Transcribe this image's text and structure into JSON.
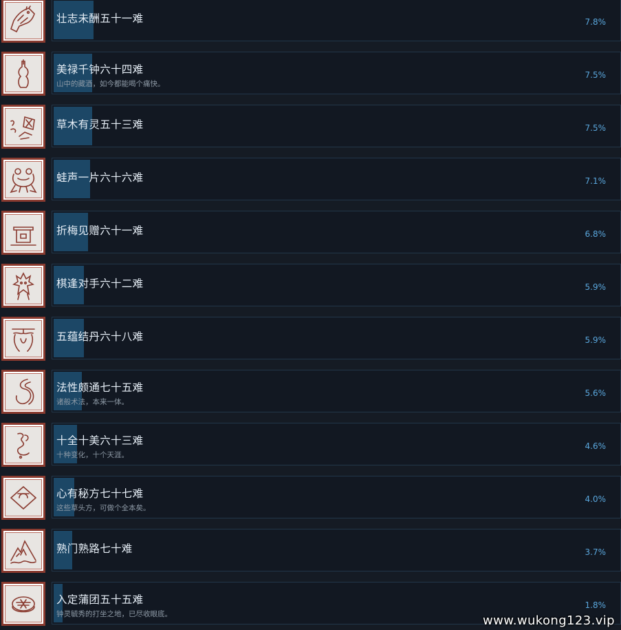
{
  "achievements": [
    {
      "title": "壮志未酬五十一难",
      "desc": "",
      "percent": "7.8%",
      "value": 7.8,
      "icon": "horse-head-icon"
    },
    {
      "title": "美禄千钟六十四难",
      "desc": "山中的藏酒，如今都能喝个痛快。",
      "percent": "7.5%",
      "value": 7.5,
      "icon": "wine-bottle-icon"
    },
    {
      "title": "草木有灵五十三难",
      "desc": "",
      "percent": "7.5%",
      "value": 7.5,
      "icon": "plants-icon"
    },
    {
      "title": "蛙声一片六十六难",
      "desc": "",
      "percent": "7.1%",
      "value": 7.1,
      "icon": "frog-icon"
    },
    {
      "title": "折梅见赠六十一难",
      "desc": "",
      "percent": "6.8%",
      "value": 6.8,
      "icon": "house-icon"
    },
    {
      "title": "棋逢对手六十二难",
      "desc": "",
      "percent": "5.9%",
      "value": 5.9,
      "icon": "demon-figure-icon"
    },
    {
      "title": "五蕴结丹六十八难",
      "desc": "",
      "percent": "5.9%",
      "value": 5.9,
      "icon": "elder-face-icon"
    },
    {
      "title": "法性颇通七十五难",
      "desc": "诸般术法，本来一体。",
      "percent": "5.6%",
      "value": 5.6,
      "icon": "swirl-icon"
    },
    {
      "title": "十全十美六十三难",
      "desc": "十种变化，十个天涯。",
      "percent": "4.6%",
      "value": 4.6,
      "icon": "smoke-icon"
    },
    {
      "title": "心有秘方七十七难",
      "desc": "这些草头方，可做个全本矣。",
      "percent": "4.0%",
      "value": 4.0,
      "icon": "recipe-cloth-icon"
    },
    {
      "title": "熟门熟路七十难",
      "desc": "",
      "percent": "3.7%",
      "value": 3.7,
      "icon": "mountain-icon"
    },
    {
      "title": "入定蒲团五十五难",
      "desc": "钟灵毓秀的打坐之地，已尽收眼底。",
      "percent": "1.8%",
      "value": 1.8,
      "icon": "cushion-icon"
    }
  ],
  "watermark": "www.wukong123.vip",
  "colors": {
    "background": "#151b24",
    "bar_fill": "#1c4766",
    "bar_border": "#22374a",
    "percent_text": "#5aa7dd",
    "icon_frame": "#8a3b30"
  }
}
